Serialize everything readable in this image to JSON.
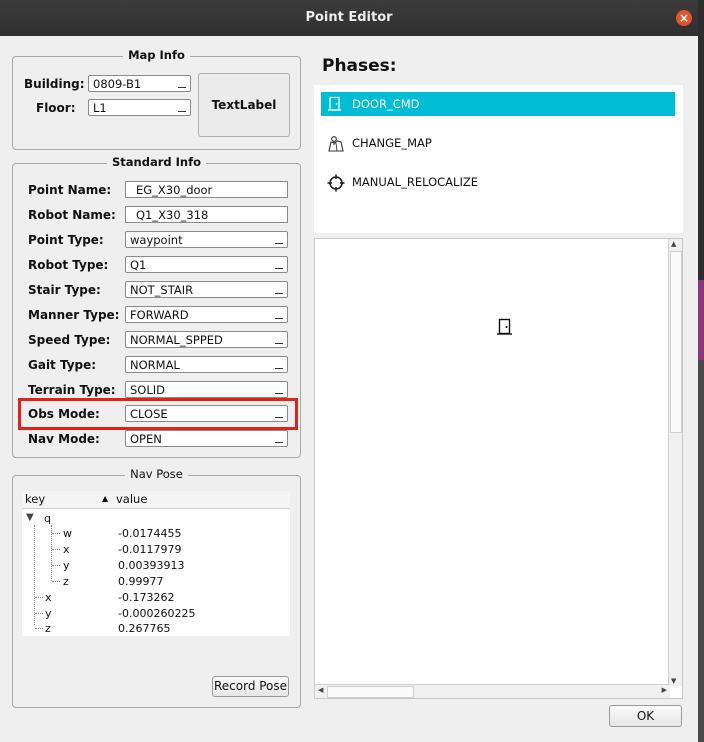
{
  "window": {
    "title": "Point Editor"
  },
  "map_info": {
    "title": "Map Info",
    "building_label": "Building:",
    "building_value": "0809-B1",
    "floor_label": "Floor:",
    "floor_value": "L1",
    "text_label": "TextLabel"
  },
  "standard_info": {
    "title": "Standard Info",
    "point_name_label": "Point Name:",
    "point_name_value": "EG_X30_door",
    "robot_name_label": "Robot Name:",
    "robot_name_value": "Q1_X30_318",
    "point_type_label": "Point Type:",
    "point_type_value": "waypoint",
    "robot_type_label": "Robot Type:",
    "robot_type_value": "Q1",
    "stair_type_label": "Stair Type:",
    "stair_type_value": "NOT_STAIR",
    "manner_type_label": "Manner Type:",
    "manner_type_value": "FORWARD",
    "speed_type_label": "Speed Type:",
    "speed_type_value": "NORMAL_SPPED",
    "gait_type_label": "Gait Type:",
    "gait_type_value": "NORMAL",
    "terrain_type_label": "Terrain Type:",
    "terrain_type_value": "SOLID",
    "obs_mode_label": "Obs Mode:",
    "obs_mode_value": "CLOSE",
    "nav_mode_label": "Nav Mode:",
    "nav_mode_value": "OPEN"
  },
  "nav_pose": {
    "title": "Nav Pose",
    "col_key": "key",
    "col_value": "value",
    "rows": [
      {
        "key": "q",
        "value": ""
      },
      {
        "key": "w",
        "value": "-0.0174455"
      },
      {
        "key": "x",
        "value": "-0.0117979"
      },
      {
        "key": "y",
        "value": "0.00393913"
      },
      {
        "key": "z",
        "value": "0.99977"
      },
      {
        "key": "x",
        "value": "-0.173262"
      },
      {
        "key": "y",
        "value": "-0.000260225"
      },
      {
        "key": "z",
        "value": "0.267765"
      }
    ],
    "record_button": "Record Pose"
  },
  "phases": {
    "title": "Phases:",
    "items": [
      {
        "label": "DOOR_CMD",
        "icon": "door-icon",
        "selected": true
      },
      {
        "label": "CHANGE_MAP",
        "icon": "map-icon",
        "selected": false
      },
      {
        "label": "MANUAL_RELOCALIZE",
        "icon": "crosshair-icon",
        "selected": false
      }
    ]
  },
  "canvas": {
    "icon": "door-icon"
  },
  "footer": {
    "ok_button": "OK"
  },
  "colors": {
    "selection": "#00bcd4",
    "highlight_box": "#e3211b",
    "close_button": "#e0542e"
  }
}
